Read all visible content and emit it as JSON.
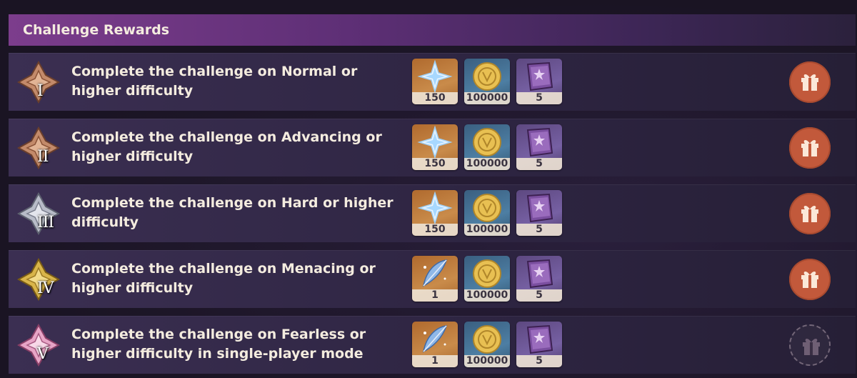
{
  "header": {
    "title": "Challenge Rewards"
  },
  "colors": {
    "tier_bronze": "#c38a6a",
    "tier_silver": "#b8bcc8",
    "tier_gold": "#d9b54a",
    "tier_pink": "#e7a5c6",
    "gift_active": "#c2593b"
  },
  "rows": [
    {
      "numeral": "I",
      "tier_color": "bronze",
      "task": "Complete the challenge on Normal or higher difficulty",
      "rewards": [
        {
          "icon": "primogem-icon",
          "count": "150"
        },
        {
          "icon": "mora-coin-icon",
          "count": "100000"
        },
        {
          "icon": "purple-book-icon",
          "count": "5"
        }
      ],
      "claim_state": "available"
    },
    {
      "numeral": "II",
      "tier_color": "bronze",
      "task": "Complete the challenge on Advancing or higher difficulty",
      "rewards": [
        {
          "icon": "primogem-icon",
          "count": "150"
        },
        {
          "icon": "mora-coin-icon",
          "count": "100000"
        },
        {
          "icon": "purple-book-icon",
          "count": "5"
        }
      ],
      "claim_state": "available"
    },
    {
      "numeral": "III",
      "tier_color": "silver",
      "task": "Complete the challenge on Hard or higher difficulty",
      "rewards": [
        {
          "icon": "primogem-icon",
          "count": "150"
        },
        {
          "icon": "mora-coin-icon",
          "count": "100000"
        },
        {
          "icon": "purple-book-icon",
          "count": "5"
        }
      ],
      "claim_state": "available"
    },
    {
      "numeral": "IV",
      "tier_color": "gold",
      "task": "Complete the challenge on Menacing or higher difficulty",
      "rewards": [
        {
          "icon": "blue-feather-icon",
          "count": "1"
        },
        {
          "icon": "mora-coin-icon",
          "count": "100000"
        },
        {
          "icon": "purple-book-icon",
          "count": "5"
        }
      ],
      "claim_state": "available"
    },
    {
      "numeral": "V",
      "tier_color": "pink",
      "task": "Complete the challenge on Fearless or higher difficulty in single-player mode",
      "rewards": [
        {
          "icon": "blue-feather-icon",
          "count": "1"
        },
        {
          "icon": "mora-coin-icon",
          "count": "100000"
        },
        {
          "icon": "purple-book-icon",
          "count": "5"
        }
      ],
      "claim_state": "unavailable"
    }
  ]
}
